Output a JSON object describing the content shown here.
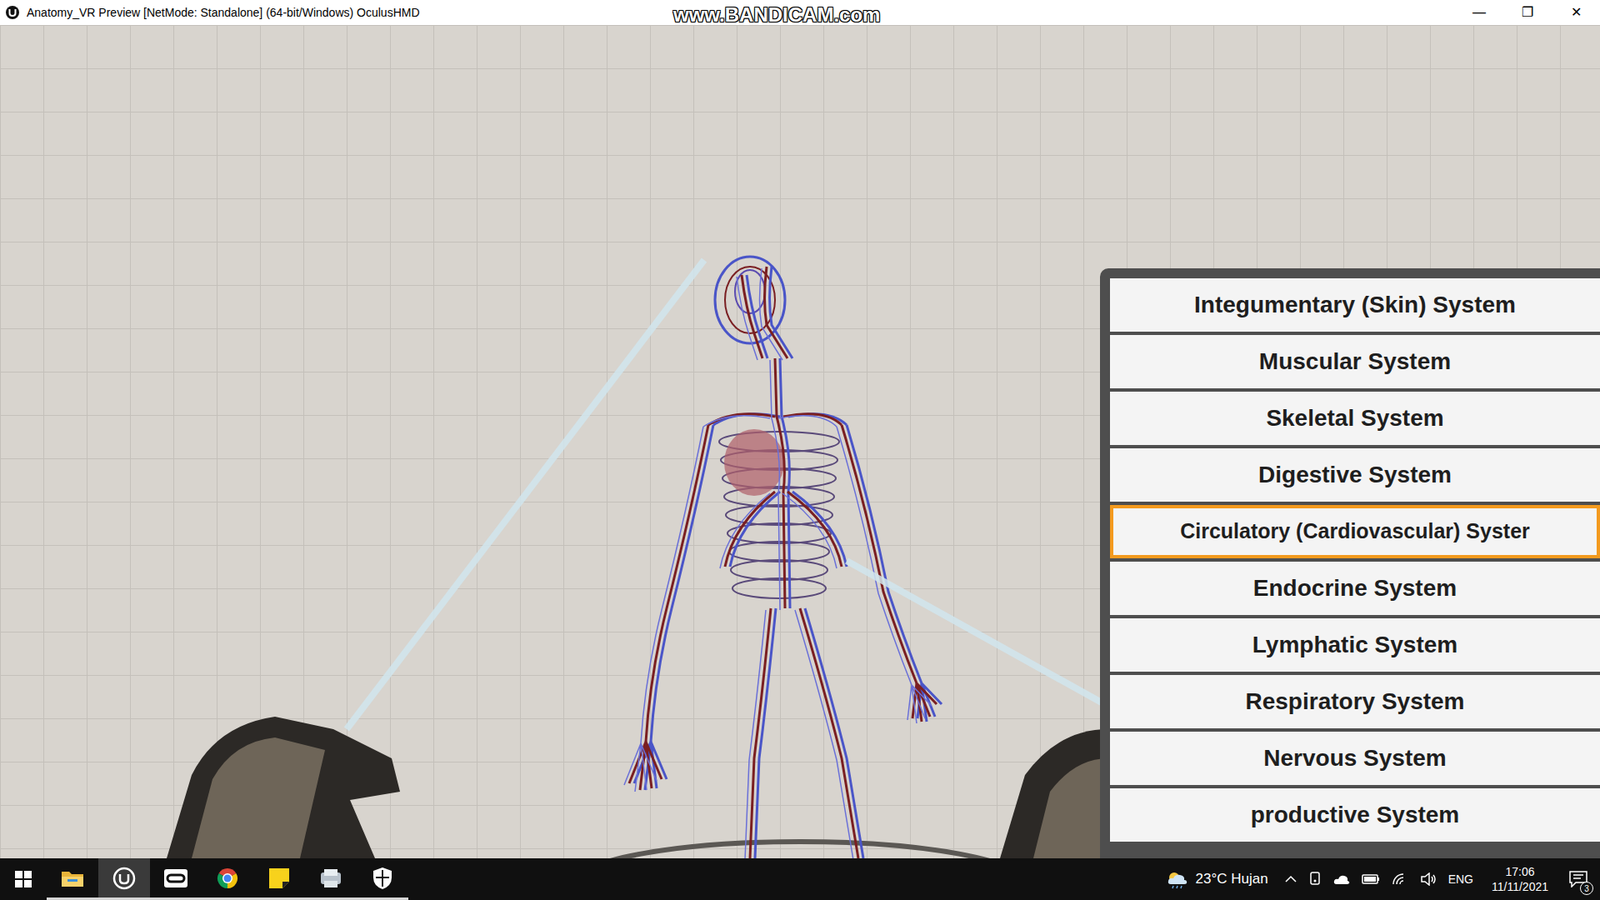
{
  "window": {
    "title": "Anatomy_VR Preview [NetMode: Standalone] (64-bit/Windows) OculusHMD",
    "controls": [
      "—",
      "❐",
      "✕"
    ]
  },
  "watermark": "www.BANDICAM.com",
  "menu": {
    "items": [
      {
        "label": "Integumentary (Skin) System",
        "selected": false
      },
      {
        "label": "Muscular System",
        "selected": false
      },
      {
        "label": "Skeletal System",
        "selected": false
      },
      {
        "label": "Digestive System",
        "selected": false
      },
      {
        "label": "Circulatory (Cardiovascular) Syster",
        "selected": true
      },
      {
        "label": "Endocrine System",
        "selected": false
      },
      {
        "label": "Lymphatic System",
        "selected": false
      },
      {
        "label": "Respiratory System",
        "selected": false
      },
      {
        "label": "Nervous System",
        "selected": false
      },
      {
        "label": "productive System",
        "selected": false
      }
    ]
  },
  "taskbar": {
    "apps": [
      {
        "kind": "explorer",
        "running": true,
        "focused": false
      },
      {
        "kind": "unreal",
        "running": true,
        "focused": true
      },
      {
        "kind": "oculus",
        "running": true,
        "focused": false
      },
      {
        "kind": "chrome",
        "running": true,
        "focused": false
      },
      {
        "kind": "sticky",
        "running": true,
        "focused": false
      },
      {
        "kind": "app",
        "running": true,
        "focused": false
      },
      {
        "kind": "shield",
        "running": true,
        "focused": false
      }
    ],
    "weather": "23°C Hujan",
    "language": "ENG",
    "time": "17:06",
    "date": "11/11/2021",
    "notifications": "3"
  }
}
